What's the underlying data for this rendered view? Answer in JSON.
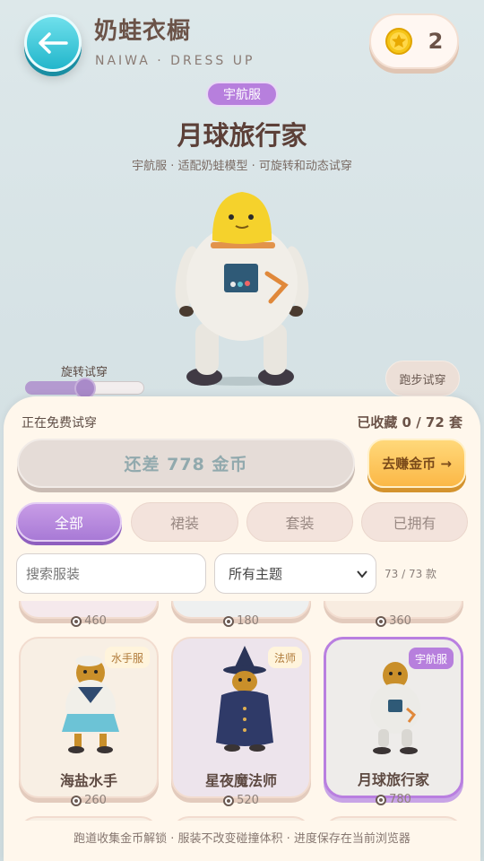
{
  "header": {
    "title": "奶蛙衣橱",
    "subtitle": "NAIWA · DRESS UP",
    "coins": "2"
  },
  "preview": {
    "badge": "宇航服",
    "name": "月球旅行家",
    "desc": "宇航服 · 适配奶蛙模型 · 可旋转和动态试穿",
    "rotate_label": "旋转试穿",
    "rotate_level": 0.5,
    "run_button": "跑步试穿"
  },
  "panel": {
    "trying_label": "正在免费试穿",
    "collected": "已收藏 0 / 72 套",
    "need_button": "还差 778 金币",
    "earn_button": "去赚金币 →",
    "tabs": [
      "全部",
      "裙装",
      "套装",
      "已拥有"
    ],
    "search_placeholder": "搜索服装",
    "theme_select": "所有主题",
    "count": "73 / 73 款"
  },
  "cards_top": [
    {
      "price": "460"
    },
    {
      "price": "180"
    },
    {
      "price": "360"
    }
  ],
  "cards": [
    {
      "name": "海盐水手",
      "tag": "水手服",
      "price": "260"
    },
    {
      "name": "星夜魔法师",
      "tag": "法师",
      "price": "520"
    },
    {
      "name": "月球旅行家",
      "tag": "宇航服",
      "price": "780"
    }
  ],
  "footer": "跑道收集金币解锁 · 服装不改变碰撞体积 · 进度保存在当前浏览器",
  "colors": {
    "accent_purple": "#b77fdd",
    "back_teal": "#22b6cb",
    "gold": "#fbb847"
  }
}
